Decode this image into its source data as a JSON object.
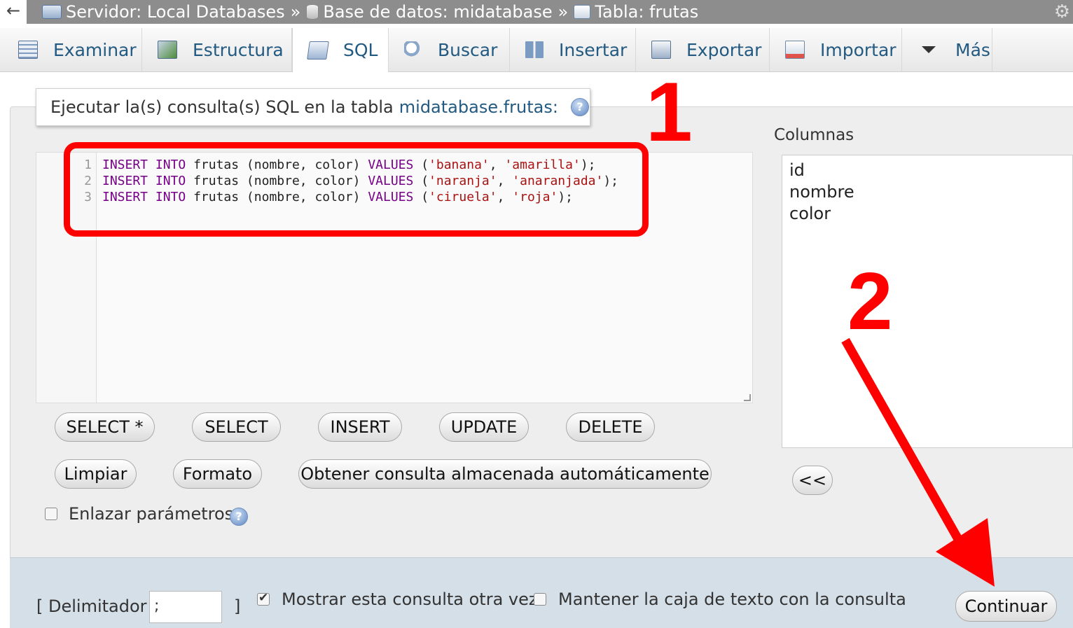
{
  "breadcrumb": {
    "back_icon": "←",
    "server": "Servidor: Local Databases",
    "database": "Base de datos: midatabase",
    "table": "Tabla: frutas",
    "separator": "»"
  },
  "tabs": [
    {
      "label": "Examinar",
      "icon": "browse-icon"
    },
    {
      "label": "Estructura",
      "icon": "structure-icon"
    },
    {
      "label": "SQL",
      "icon": "sql-icon",
      "active": true
    },
    {
      "label": "Buscar",
      "icon": "search-icon"
    },
    {
      "label": "Insertar",
      "icon": "insert-icon"
    },
    {
      "label": "Exportar",
      "icon": "export-icon"
    },
    {
      "label": "Importar",
      "icon": "import-icon"
    },
    {
      "label": "Más",
      "icon": "more-caret-icon"
    }
  ],
  "query_panel": {
    "title_prefix": "Ejecutar la(s) consulta(s) SQL en la tabla",
    "title_link": "midatabase.frutas:",
    "help_glyph": "?"
  },
  "editor": {
    "lines": [
      {
        "num": "1",
        "parts": [
          [
            "kw",
            "INSERT"
          ],
          [
            "t",
            " "
          ],
          [
            "kw",
            "INTO"
          ],
          [
            "t",
            " frutas (nombre, color) "
          ],
          [
            "kw",
            "VALUES"
          ],
          [
            "t",
            " ("
          ],
          [
            "str",
            "'banana'"
          ],
          [
            "t",
            ", "
          ],
          [
            "str",
            "'amarilla'"
          ],
          [
            "t",
            ");"
          ]
        ]
      },
      {
        "num": "2",
        "parts": [
          [
            "kw",
            "INSERT"
          ],
          [
            "t",
            " "
          ],
          [
            "kw",
            "INTO"
          ],
          [
            "t",
            " frutas (nombre, color) "
          ],
          [
            "kw",
            "VALUES"
          ],
          [
            "t",
            " ("
          ],
          [
            "str",
            "'naranja'"
          ],
          [
            "t",
            ", "
          ],
          [
            "str",
            "'anaranjada'"
          ],
          [
            "t",
            ");"
          ]
        ]
      },
      {
        "num": "3",
        "parts": [
          [
            "kw",
            "INSERT"
          ],
          [
            "t",
            " "
          ],
          [
            "kw",
            "INTO"
          ],
          [
            "t",
            " frutas (nombre, color) "
          ],
          [
            "kw",
            "VALUES"
          ],
          [
            "t",
            " ("
          ],
          [
            "str",
            "'ciruela'"
          ],
          [
            "t",
            ", "
          ],
          [
            "str",
            "'roja'"
          ],
          [
            "t",
            ");"
          ]
        ]
      }
    ]
  },
  "query_buttons": {
    "select_star": "SELECT *",
    "select": "SELECT",
    "insert": "INSERT",
    "update": "UPDATE",
    "delete": "DELETE",
    "clear": "Limpiar",
    "format": "Formato",
    "get_auto_saved": "Obtener consulta almacenada automáticamente"
  },
  "bind_params": {
    "label": "Enlazar parámetros",
    "checked": false
  },
  "columns": {
    "title": "Columnas",
    "items": [
      "id",
      "nombre",
      "color"
    ],
    "insert_button": "<<"
  },
  "footer": {
    "delimiter_open": "[ Delimitador",
    "delimiter_value": ";",
    "delimiter_close": "]",
    "show_query_again": {
      "label": "Mostrar esta consulta otra vez",
      "checked": true
    },
    "keep_textbox": {
      "label": "Mantener la caja de texto con la consulta",
      "checked": false
    },
    "submit": "Continuar"
  },
  "annotations": {
    "step1": "1",
    "step2": "2",
    "color": "#ff0000"
  }
}
